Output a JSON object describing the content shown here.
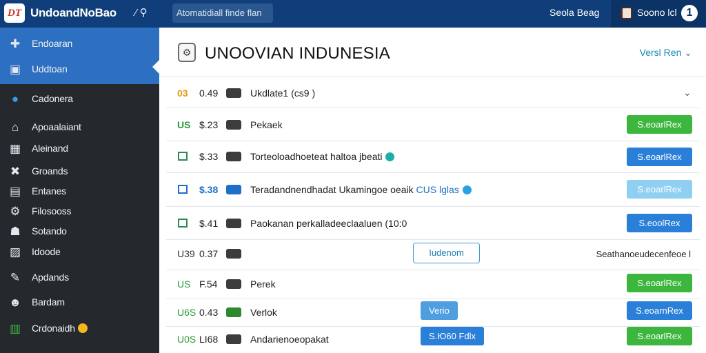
{
  "topbar": {
    "logo_text": "DT",
    "app_title": "UndoandNoBao",
    "tools_label": "⁄ ⚲",
    "search_text": "Atomatidiall finde flan",
    "link": "Seola Beag",
    "user_name": "Soono lcl",
    "badge": "1"
  },
  "sidebar": {
    "items": [
      {
        "icon": "puzzle-icon",
        "glyph": "✚",
        "label": "Endoaran"
      },
      {
        "icon": "image-icon",
        "glyph": "▣",
        "label": "Uddtoan"
      },
      {
        "icon": "globe-icon",
        "glyph": "●",
        "label": "Cadonera"
      },
      {
        "icon": "home-icon",
        "glyph": "⌂",
        "label": "Apoaalaiant"
      },
      {
        "icon": "grid-icon",
        "glyph": "▦",
        "label": "Aleinand"
      },
      {
        "icon": "circle-x-icon",
        "glyph": "✖",
        "label": "Groands"
      },
      {
        "icon": "folder-icon",
        "glyph": "▤",
        "label": "Entanes"
      },
      {
        "icon": "gear-icon",
        "glyph": "⚙",
        "label": "Filosooss"
      },
      {
        "icon": "people-icon",
        "glyph": "☗",
        "label": "Sotando"
      },
      {
        "icon": "picture-icon",
        "glyph": "▨",
        "label": "Idoode"
      },
      {
        "icon": "wrench-icon",
        "glyph": "✎",
        "label": "Apdands"
      },
      {
        "icon": "user-icon",
        "glyph": "☻",
        "label": "Bardam"
      },
      {
        "icon": "chart-icon",
        "glyph": "▥",
        "label": "Crdonaidh"
      }
    ]
  },
  "main": {
    "title": "UNOOVIAN INDUNESIA",
    "version_select": "Versl Ren ⌄",
    "rows": [
      {
        "code": "03",
        "price": "0.49",
        "desc": "Ukdlate1 (cs9 )"
      },
      {
        "code": "US",
        "price": "$.23",
        "desc": "Pekaek",
        "button": "S.eoarlRex"
      },
      {
        "price": "$.33",
        "desc": "Torteoloadhoeteat haltoa jbeati",
        "button": "S.eoarlRex"
      },
      {
        "price": "$.38",
        "desc": "Teradandnendhadat Ukamingoe oeaik",
        "desc_link": "CUS lglas",
        "button": "S.eoarlRex"
      },
      {
        "price": "$.41",
        "desc": "Paokanan perkalladeeclaaluen (10:0",
        "button": "S.eoolRex"
      },
      {
        "code": "U39",
        "price": "0.37",
        "outline_button": "Iudenom",
        "right_text": "Seathanoeudecenfeoe l"
      },
      {
        "code": "US",
        "price": "F.54",
        "desc": "Perek",
        "button": "S.eoarlRex"
      },
      {
        "code": "U6S",
        "price": "0.43",
        "desc": "Verlok",
        "mid_button": "Verio",
        "button": "S.eoarnRex"
      },
      {
        "code": "U0S",
        "price": "LI68",
        "desc": "Andarienoeopakat",
        "mid_button": "S.Ю60 Fdlx",
        "button": "S.eoarlRex"
      }
    ]
  },
  "colors": {
    "topbar": "#0f3e7a",
    "sidebar": "#25292e",
    "sidebar_active": "#2d6fc0",
    "green": "#3cb63c",
    "blue": "#2a7fd8"
  }
}
